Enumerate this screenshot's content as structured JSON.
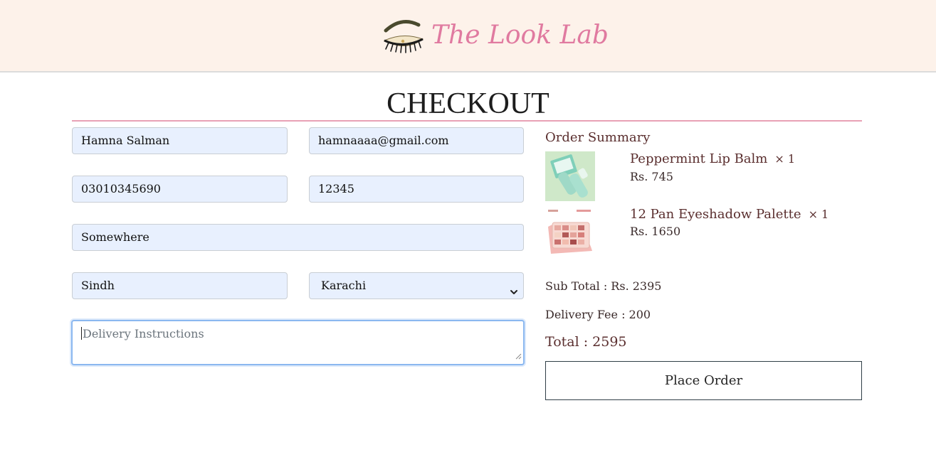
{
  "header": {
    "brand_name": "The Look Lab",
    "background": "#fdf2ea",
    "brand_color": "#e07aa0",
    "logo_icon": "eyelash-icon"
  },
  "page": {
    "title": "CHECKOUT",
    "rule_color": "#e8a1b5"
  },
  "form": {
    "full_name": {
      "value": "Hamna Salman"
    },
    "email": {
      "value": "hamnaaaa@gmail.com"
    },
    "phone": {
      "value": "03010345690"
    },
    "postal_code": {
      "value": "12345"
    },
    "address": {
      "value": "Somewhere"
    },
    "province": {
      "value": "Sindh"
    },
    "city": {
      "selected": "Karachi"
    },
    "delivery_instructions": {
      "value": "",
      "placeholder": "Delivery Instructions"
    },
    "field_fill_color": "#e8f0fe"
  },
  "summary": {
    "title": "Order Summary",
    "items": [
      {
        "name": "Peppermint Lip Balm",
        "qty": "× 1",
        "price": "Rs. 745",
        "thumb_icon": "lip-balm-product-icon"
      },
      {
        "name": "12 Pan Eyeshadow Palette",
        "qty": "× 1",
        "price": "Rs. 1650",
        "thumb_icon": "eyeshadow-palette-product-icon"
      }
    ],
    "subtotal": "Sub Total : Rs. 2395",
    "delivery_fee": "Delivery Fee : 200",
    "total": "Total : 2595",
    "place_order_label": "Place Order",
    "accent_text_color": "#5a2e2e"
  }
}
